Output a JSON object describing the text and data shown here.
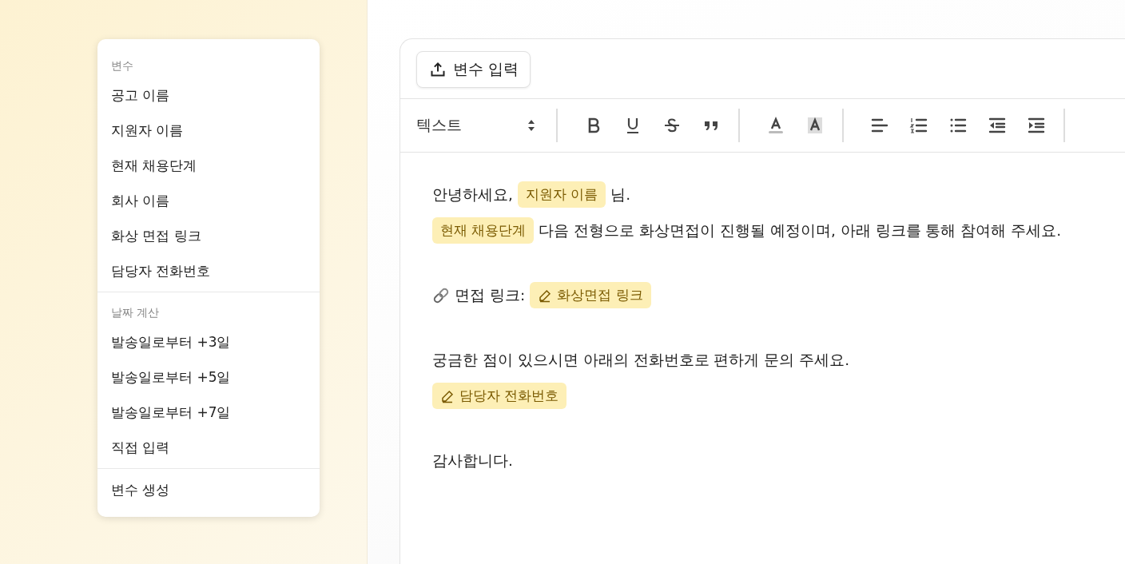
{
  "variable_menu": {
    "sections": [
      {
        "heading": "변수",
        "items": [
          "공고 이름",
          "지원자 이름",
          "현재 채용단계",
          "회사 이름",
          "화상 면접 링크",
          "담당자 전화번호"
        ]
      },
      {
        "heading": "날짜 계산",
        "items": [
          "발송일로부터 +3일",
          "발송일로부터 +5일",
          "발송일로부터 +7일",
          "직접 입력"
        ]
      },
      {
        "items": [
          "변수 생성"
        ]
      }
    ]
  },
  "editor": {
    "insert_button": "변수 입력",
    "toolbar": {
      "format_select": "텍스트",
      "groups": [
        [
          {
            "kind": "bold"
          },
          {
            "kind": "underline"
          },
          {
            "kind": "strikethrough"
          },
          {
            "kind": "quote"
          }
        ],
        [
          {
            "kind": "text-color"
          },
          {
            "kind": "highlight"
          }
        ],
        [
          {
            "kind": "align-left"
          },
          {
            "kind": "ordered-list"
          },
          {
            "kind": "bullet-list"
          },
          {
            "kind": "outdent"
          },
          {
            "kind": "indent"
          }
        ]
      ]
    },
    "paragraphs": [
      [
        [
          {
            "kind": "text",
            "text": "안녕하세요,"
          },
          {
            "kind": "chip",
            "text": "지원자 이름"
          },
          {
            "kind": "text",
            "text": "님."
          }
        ],
        [
          {
            "kind": "chip",
            "text": "현재 채용단계"
          },
          {
            "kind": "text",
            "text": "다음 전형으로 화상면접이 진행될 예정이며, 아래 링크를 통해 참여해 주세요."
          }
        ]
      ],
      [
        [
          {
            "kind": "link-icon"
          },
          {
            "kind": "text",
            "text": "면접 링크:"
          },
          {
            "kind": "pencil-chip",
            "text": "화상면접 링크"
          }
        ]
      ],
      [
        [
          {
            "kind": "text",
            "text": "궁금한 점이 있으시면 아래의 전화번호로 편하게 문의 주세요."
          }
        ],
        [
          {
            "kind": "pencil-chip",
            "text": "담당자 전화번호"
          }
        ]
      ],
      [
        [
          {
            "kind": "text",
            "text": "감사합니다."
          }
        ]
      ]
    ]
  }
}
